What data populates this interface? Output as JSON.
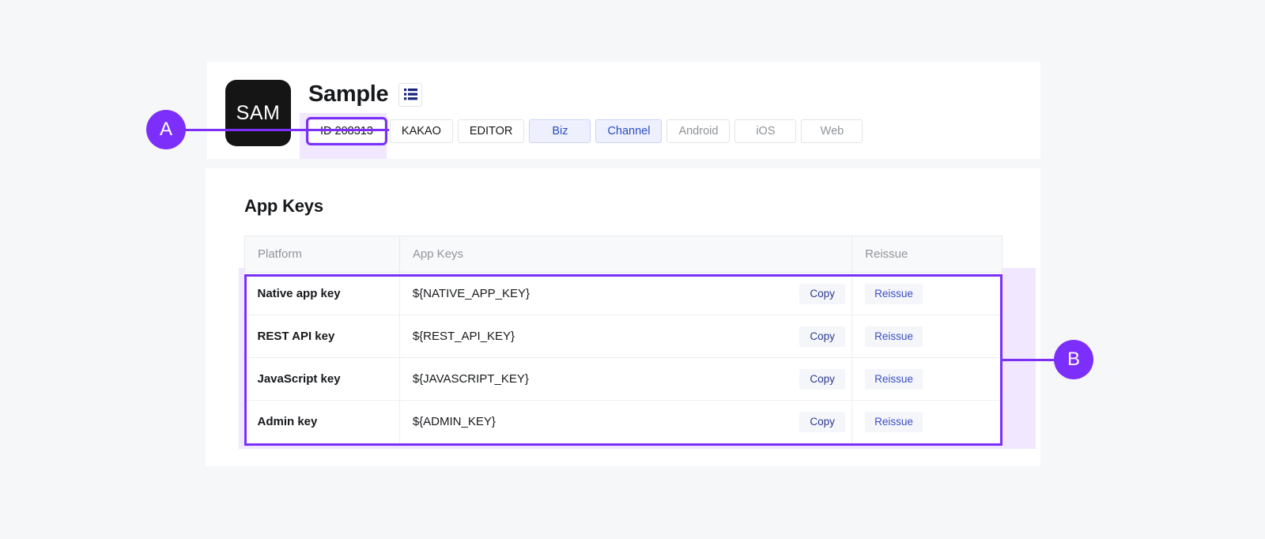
{
  "colors": {
    "accent_purple": "#7c2ffa",
    "highlight_lavender": "#f1e8ff",
    "page_background": "#f6f7f8",
    "card_background": "#ffffff",
    "chip_blue_bg": "#eef1fd",
    "chip_blue_text": "#2a4bc0",
    "muted_text": "#8d9299"
  },
  "annotations": [
    {
      "label": "A",
      "target": "app-id-chip"
    },
    {
      "label": "B",
      "target": "app-keys-table-rows"
    }
  ],
  "header": {
    "logo_text": "SAM",
    "app_title": "Sample",
    "list_icon": "list-icon",
    "chips": [
      {
        "label": "ID 208313",
        "style": "default",
        "selected": true
      },
      {
        "label": "KAKAO",
        "style": "default",
        "selected": false
      },
      {
        "label": "EDITOR",
        "style": "default",
        "selected": false
      },
      {
        "label": "Biz",
        "style": "blue",
        "selected": false
      },
      {
        "label": "Channel",
        "style": "blue",
        "selected": false
      },
      {
        "label": "Android",
        "style": "muted",
        "selected": false
      },
      {
        "label": "iOS",
        "style": "muted",
        "selected": false
      },
      {
        "label": "Web",
        "style": "muted",
        "selected": false
      }
    ]
  },
  "app_keys": {
    "section_title": "App Keys",
    "columns": [
      "Platform",
      "App Keys",
      "Reissue"
    ],
    "copy_label": "Copy",
    "reissue_label": "Reissue",
    "rows": [
      {
        "platform": "Native app key",
        "key": "${NATIVE_APP_KEY}",
        "copy": "Copy",
        "reissue": "Reissue"
      },
      {
        "platform": "REST API key",
        "key": "${REST_API_KEY}",
        "copy": "Copy",
        "reissue": "Reissue"
      },
      {
        "platform": "JavaScript key",
        "key": "${JAVASCRIPT_KEY}",
        "copy": "Copy",
        "reissue": "Reissue"
      },
      {
        "platform": "Admin key",
        "key": "${ADMIN_KEY}",
        "copy": "Copy",
        "reissue": "Reissue"
      }
    ]
  }
}
